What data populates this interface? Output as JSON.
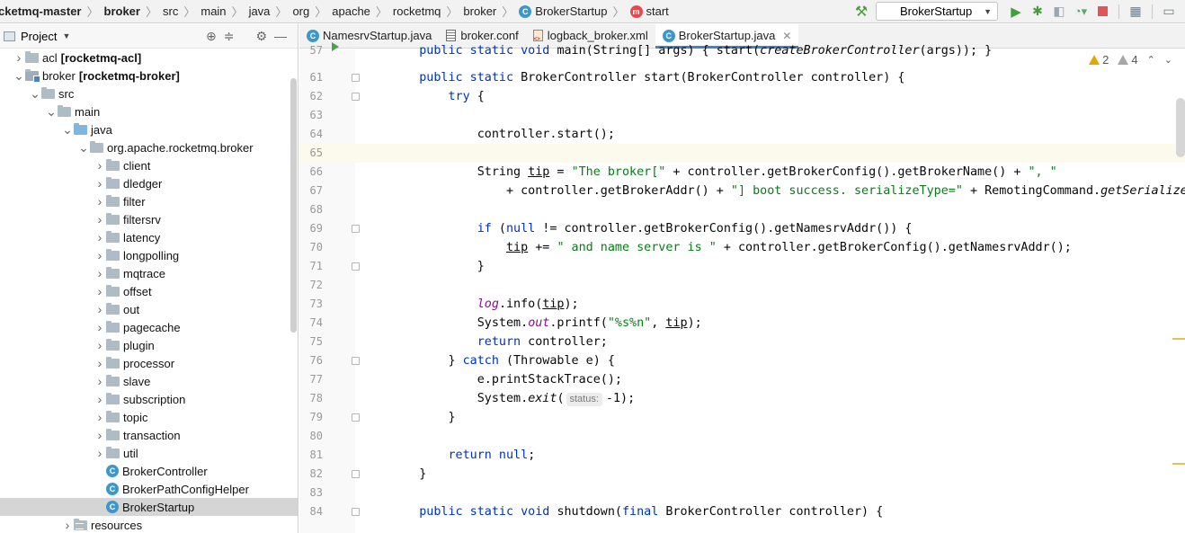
{
  "breadcrumbs": [
    {
      "label": "cketmq-master",
      "bold": true
    },
    {
      "label": "broker",
      "bold": true
    },
    {
      "label": "src"
    },
    {
      "label": "main"
    },
    {
      "label": "java"
    },
    {
      "label": "org"
    },
    {
      "label": "apache"
    },
    {
      "label": "rocketmq"
    },
    {
      "label": "broker"
    },
    {
      "label": "BrokerStartup",
      "icon": "class-icon"
    },
    {
      "label": "start",
      "icon": "method-icon"
    }
  ],
  "toolbar": {
    "run_config": "BrokerStartup",
    "icons": [
      "build-hammer-icon",
      "run-icon",
      "debug-icon",
      "coverage-icon",
      "profile-icon",
      "stop-icon",
      "project-structure-icon",
      "window-icon"
    ]
  },
  "project_pane": {
    "title": "Project",
    "tree": [
      {
        "indent": 1,
        "arrow": "›",
        "icon": "folder",
        "text": "acl",
        "bold_text": "[rocketmq-acl]"
      },
      {
        "indent": 1,
        "arrow": "⌄",
        "icon": "module",
        "text": "broker",
        "bold_text": "[rocketmq-broker]"
      },
      {
        "indent": 2,
        "arrow": "⌄",
        "icon": "folder",
        "text": "src"
      },
      {
        "indent": 3,
        "arrow": "⌄",
        "icon": "folder",
        "text": "main"
      },
      {
        "indent": 4,
        "arrow": "⌄",
        "icon": "blue-folder",
        "text": "java"
      },
      {
        "indent": 5,
        "arrow": "⌄",
        "icon": "folder",
        "text": "org.apache.rocketmq.broker"
      },
      {
        "indent": 6,
        "arrow": "›",
        "icon": "folder",
        "text": "client"
      },
      {
        "indent": 6,
        "arrow": "›",
        "icon": "folder",
        "text": "dledger"
      },
      {
        "indent": 6,
        "arrow": "›",
        "icon": "folder",
        "text": "filter"
      },
      {
        "indent": 6,
        "arrow": "›",
        "icon": "folder",
        "text": "filtersrv"
      },
      {
        "indent": 6,
        "arrow": "›",
        "icon": "folder",
        "text": "latency"
      },
      {
        "indent": 6,
        "arrow": "›",
        "icon": "folder",
        "text": "longpolling"
      },
      {
        "indent": 6,
        "arrow": "›",
        "icon": "folder",
        "text": "mqtrace"
      },
      {
        "indent": 6,
        "arrow": "›",
        "icon": "folder",
        "text": "offset"
      },
      {
        "indent": 6,
        "arrow": "›",
        "icon": "folder",
        "text": "out"
      },
      {
        "indent": 6,
        "arrow": "›",
        "icon": "folder",
        "text": "pagecache"
      },
      {
        "indent": 6,
        "arrow": "›",
        "icon": "folder",
        "text": "plugin"
      },
      {
        "indent": 6,
        "arrow": "›",
        "icon": "folder",
        "text": "processor"
      },
      {
        "indent": 6,
        "arrow": "›",
        "icon": "folder",
        "text": "slave"
      },
      {
        "indent": 6,
        "arrow": "›",
        "icon": "folder",
        "text": "subscription"
      },
      {
        "indent": 6,
        "arrow": "›",
        "icon": "folder",
        "text": "topic"
      },
      {
        "indent": 6,
        "arrow": "›",
        "icon": "folder",
        "text": "transaction"
      },
      {
        "indent": 6,
        "arrow": "›",
        "icon": "folder",
        "text": "util"
      },
      {
        "indent": 6,
        "arrow": "",
        "icon": "class",
        "text": "BrokerController"
      },
      {
        "indent": 6,
        "arrow": "",
        "icon": "class",
        "text": "BrokerPathConfigHelper"
      },
      {
        "indent": 6,
        "arrow": "",
        "icon": "class",
        "text": "BrokerStartup",
        "selected": true
      },
      {
        "indent": 4,
        "arrow": "›",
        "icon": "resources-folder",
        "text": "resources"
      }
    ]
  },
  "editor": {
    "tabs": [
      {
        "label": "NamesrvStartup.java",
        "icon": "class-icon"
      },
      {
        "label": "broker.conf",
        "icon": "config-file-icon"
      },
      {
        "label": "logback_broker.xml",
        "icon": "xml-file-icon"
      },
      {
        "label": "BrokerStartup.java",
        "icon": "class-icon",
        "active": true
      }
    ],
    "inspections": {
      "warnings": "2",
      "weak_warnings": "4"
    },
    "current_line": "65",
    "lines": [
      {
        "n": "57",
        "cut": true,
        "run": true,
        "segs": [
          [
            "    ",
            ""
          ],
          [
            "public static void ",
            "kw"
          ],
          [
            "main(String[] args) { start(",
            ""
          ],
          [
            "createBrokerController",
            "itl"
          ],
          [
            "(args)); }",
            ""
          ]
        ]
      },
      {
        "n": "61",
        "fold": true,
        "segs": [
          [
            "    ",
            ""
          ],
          [
            "public static ",
            "kw"
          ],
          [
            "BrokerController start(BrokerController controller) {",
            ""
          ]
        ]
      },
      {
        "n": "62",
        "fold": true,
        "segs": [
          [
            "        ",
            ""
          ],
          [
            "try",
            "kw"
          ],
          [
            " {",
            ""
          ]
        ]
      },
      {
        "n": "63",
        "segs": []
      },
      {
        "n": "64",
        "segs": [
          [
            "            controller.start();",
            ""
          ]
        ]
      },
      {
        "n": "65",
        "segs": []
      },
      {
        "n": "66",
        "segs": [
          [
            "            String ",
            ""
          ],
          [
            "tip",
            "ul"
          ],
          [
            " = ",
            ""
          ],
          [
            "\"The broker[\"",
            "str"
          ],
          [
            " + controller.getBrokerConfig().getBrokerName() + ",
            ""
          ],
          [
            "\", \"",
            "str"
          ]
        ]
      },
      {
        "n": "67",
        "segs": [
          [
            "                + controller.getBrokerAddr() + ",
            ""
          ],
          [
            "\"] boot success. serializeType=\"",
            "str"
          ],
          [
            " + RemotingCommand.",
            ""
          ],
          [
            "getSerializeTypeC",
            "itl"
          ]
        ]
      },
      {
        "n": "68",
        "segs": []
      },
      {
        "n": "69",
        "fold": true,
        "segs": [
          [
            "            ",
            ""
          ],
          [
            "if",
            "kw"
          ],
          [
            " (",
            ""
          ],
          [
            "null",
            "kw"
          ],
          [
            " != controller.getBrokerConfig().getNamesrvAddr()) {",
            ""
          ]
        ]
      },
      {
        "n": "70",
        "segs": [
          [
            "                ",
            ""
          ],
          [
            "tip",
            "ul"
          ],
          [
            " += ",
            ""
          ],
          [
            "\" and name server is \"",
            "str"
          ],
          [
            " + controller.getBrokerConfig().getNamesrvAddr();",
            ""
          ]
        ]
      },
      {
        "n": "71",
        "fold": true,
        "segs": [
          [
            "            }",
            ""
          ]
        ]
      },
      {
        "n": "72",
        "segs": []
      },
      {
        "n": "73",
        "segs": [
          [
            "            ",
            ""
          ],
          [
            "log",
            "fld"
          ],
          [
            ".info(",
            ""
          ],
          [
            "tip",
            "ul"
          ],
          [
            ");",
            ""
          ]
        ]
      },
      {
        "n": "74",
        "segs": [
          [
            "            System.",
            ""
          ],
          [
            "out",
            "fld"
          ],
          [
            ".printf(",
            ""
          ],
          [
            "\"%s%n\"",
            "str"
          ],
          [
            ", ",
            ""
          ],
          [
            "tip",
            "ul"
          ],
          [
            ");",
            ""
          ]
        ]
      },
      {
        "n": "75",
        "segs": [
          [
            "            ",
            ""
          ],
          [
            "return",
            "kw"
          ],
          [
            " controller;",
            ""
          ]
        ]
      },
      {
        "n": "76",
        "fold": true,
        "segs": [
          [
            "        } ",
            ""
          ],
          [
            "catch",
            "kw"
          ],
          [
            " (Throwable e) {",
            ""
          ]
        ]
      },
      {
        "n": "77",
        "segs": [
          [
            "            e.printStackTrace();",
            ""
          ]
        ]
      },
      {
        "n": "78",
        "segs": [
          [
            "            System.",
            ""
          ],
          [
            "exit",
            "itl"
          ],
          [
            "(",
            ""
          ],
          [
            "status:",
            "hint"
          ],
          [
            "-1);",
            ""
          ]
        ]
      },
      {
        "n": "79",
        "fold": true,
        "segs": [
          [
            "        }",
            ""
          ]
        ]
      },
      {
        "n": "80",
        "segs": []
      },
      {
        "n": "81",
        "segs": [
          [
            "        ",
            ""
          ],
          [
            "return null",
            "kw"
          ],
          [
            ";",
            ""
          ]
        ]
      },
      {
        "n": "82",
        "fold": true,
        "segs": [
          [
            "    }",
            ""
          ]
        ]
      },
      {
        "n": "83",
        "segs": []
      },
      {
        "n": "84",
        "fold": true,
        "segs": [
          [
            "    ",
            ""
          ],
          [
            "public static void ",
            "kw"
          ],
          [
            "shutdown(",
            ""
          ],
          [
            "final ",
            "kw"
          ],
          [
            "BrokerController controller) {",
            ""
          ]
        ]
      }
    ]
  }
}
